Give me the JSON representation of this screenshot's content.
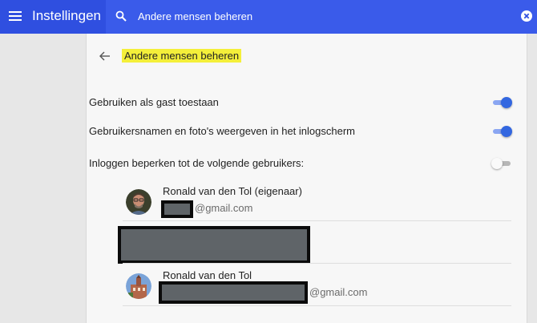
{
  "header": {
    "app_title": "Instellingen",
    "search_value": "Andere mensen beheren",
    "colors": {
      "bar": "#2f4fe0",
      "search": "#3a5bea"
    }
  },
  "page": {
    "title": "Andere mensen beheren",
    "highlight_color": "#f4ef3a"
  },
  "settings": [
    {
      "label": "Gebruiken als gast toestaan",
      "enabled": true
    },
    {
      "label": "Gebruikersnamen en foto's weergeven in het inlogscherm",
      "enabled": true
    },
    {
      "label": "Inloggen beperken tot de volgende gebruikers:",
      "enabled": false
    }
  ],
  "users": [
    {
      "name": "Ronald van den Tol (eigenaar)",
      "email_domain": "@gmail.com",
      "avatar": "person-photo"
    },
    {
      "name": "Ronald van den Tol",
      "email_domain": "@gmail.com",
      "avatar": "building-photo"
    }
  ]
}
